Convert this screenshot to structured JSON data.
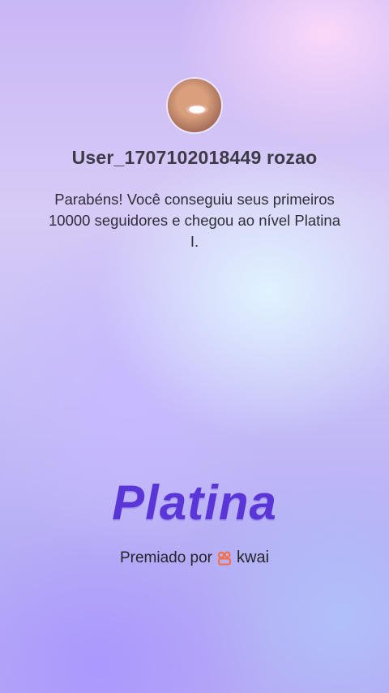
{
  "profile": {
    "username": "User_1707102018449 rozao"
  },
  "message": {
    "text": "Parabéns! Você conseguiu seus primeiros 10000 seguidores e chegou ao nível Platina I."
  },
  "level": {
    "title": "Platina"
  },
  "footer": {
    "awarded_by": "Premiado por",
    "brand": "kwai",
    "brand_icon": "kwai-logo-icon",
    "brand_color": "#ff6a3d"
  },
  "colors": {
    "title": "#5a36d6",
    "text": "#2f2d3a"
  }
}
